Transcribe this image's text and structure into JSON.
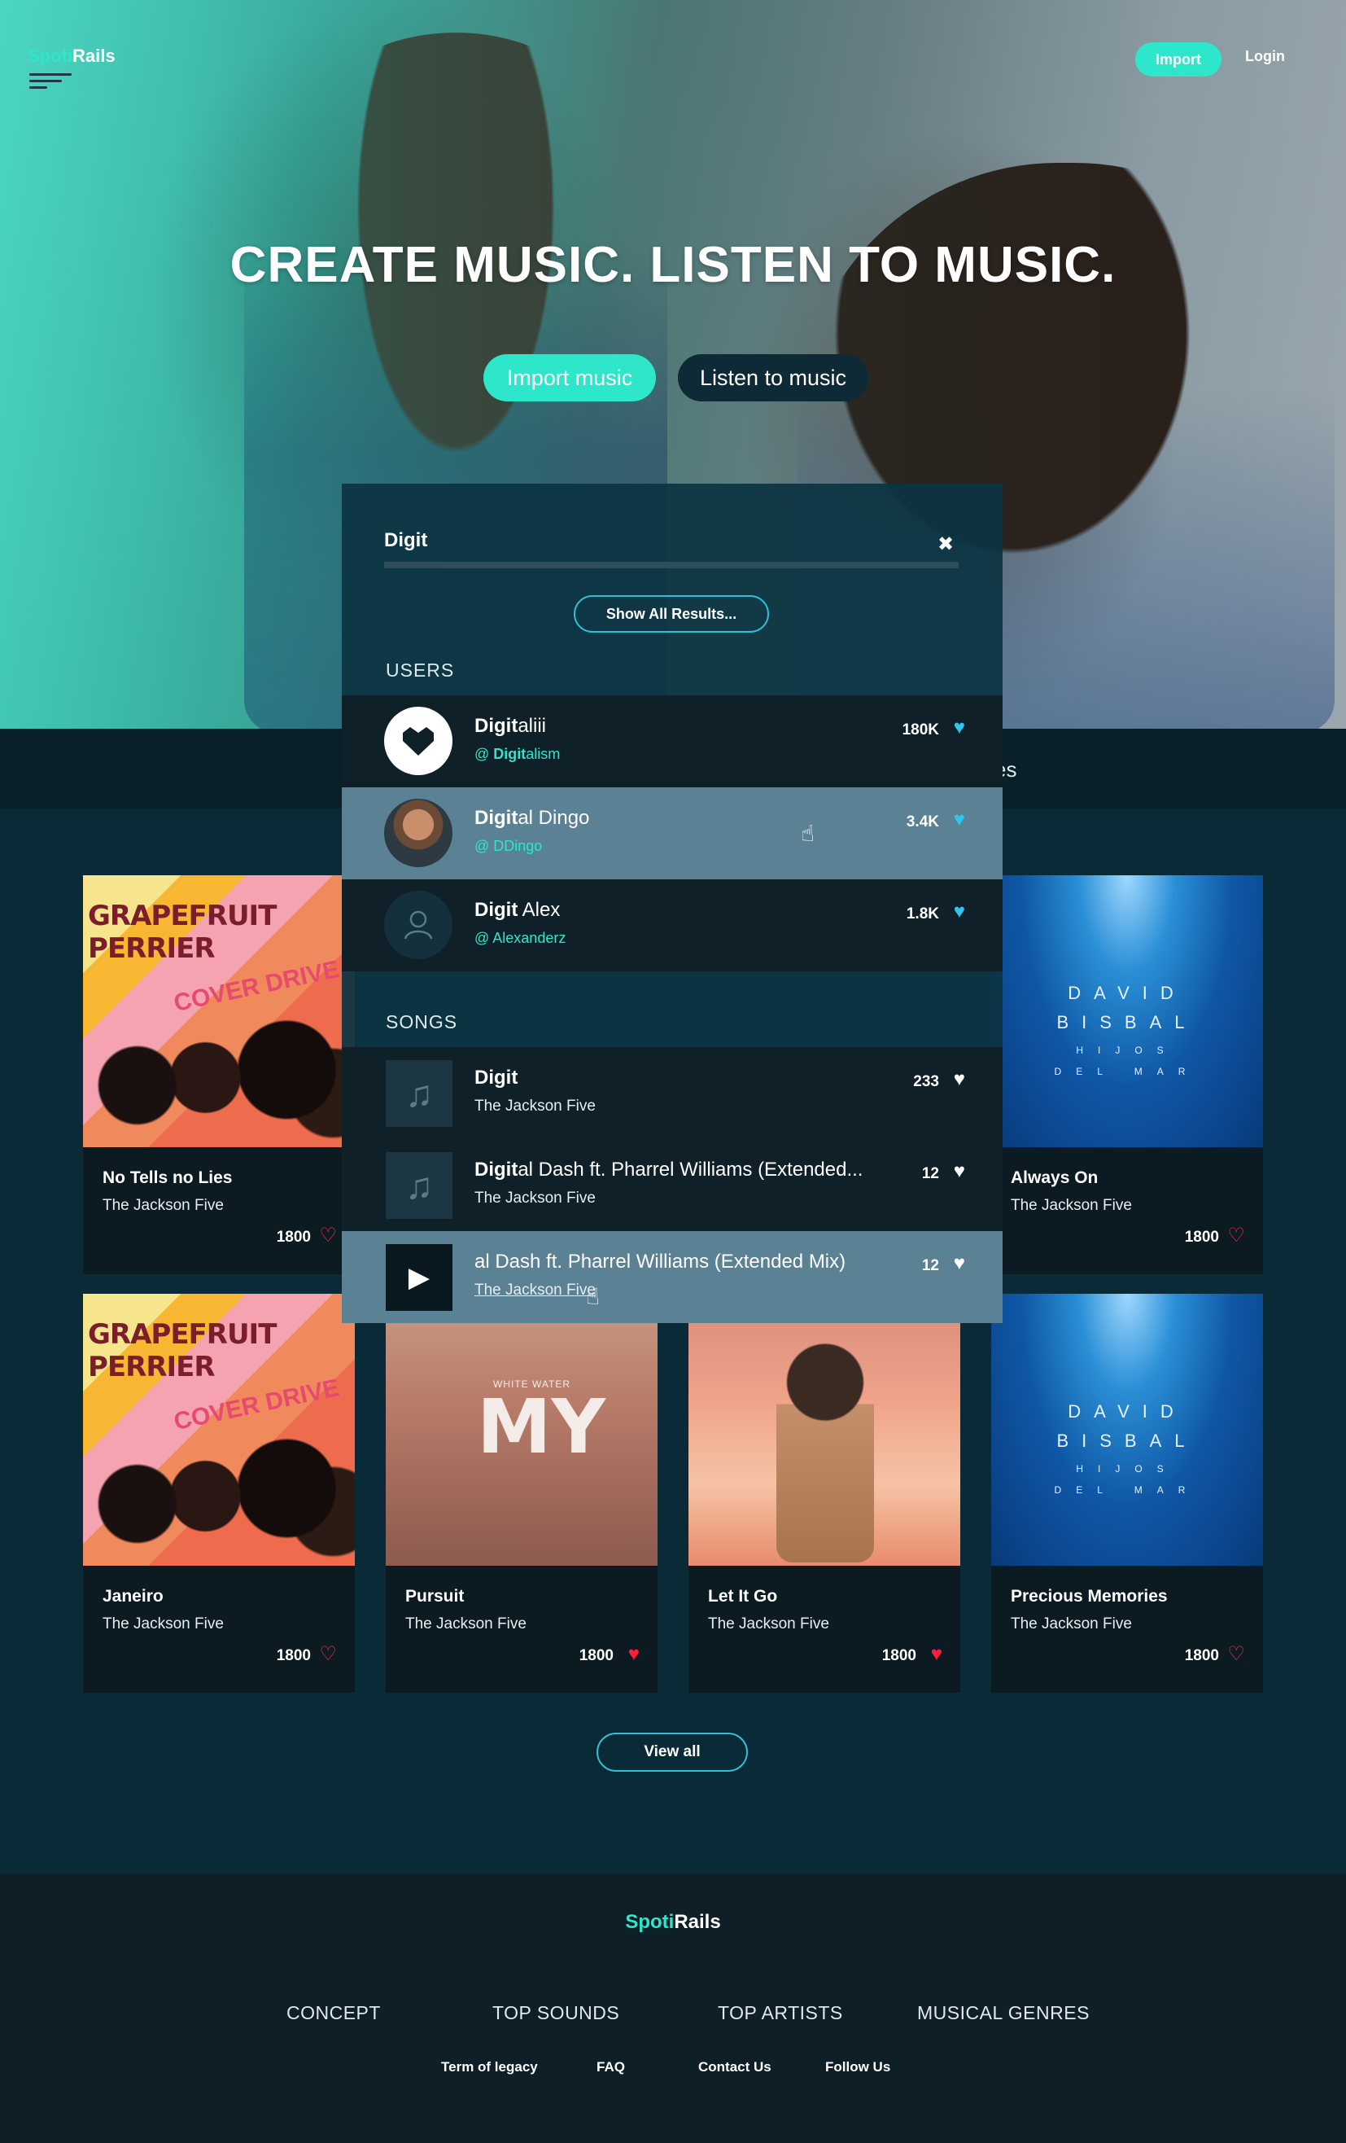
{
  "brand": {
    "part1": "Spoti",
    "part2": "Rails"
  },
  "topnav": {
    "import": "Import",
    "login": "Login"
  },
  "hero": {
    "title": "CREATE MUSIC. LISTEN TO MUSIC.",
    "btn_import": "Import music",
    "btn_listen": "Listen to music"
  },
  "filter_bar": {
    "partial_text": "es"
  },
  "search": {
    "query": "Digit",
    "show_all": "Show All Results...",
    "users_label": "USERS",
    "songs_label": "SONGS",
    "users": [
      {
        "name_match": "Digit",
        "name_rest": "aliii",
        "handle_prefix": "@ ",
        "handle_match": "Digit",
        "handle_rest": "alism",
        "count": "180K",
        "avatar": "heart-logo"
      },
      {
        "name_match": "Digit",
        "name_rest": "al Dingo",
        "handle_prefix": "@ ",
        "handle_match": "",
        "handle_rest": "DDingo",
        "count": "3.4K",
        "avatar": "photo"
      },
      {
        "name_match": "Digit",
        "name_rest": " Alex",
        "handle_prefix": "@ ",
        "handle_match": "",
        "handle_rest": "Alexanderz",
        "count": "1.8K",
        "avatar": "placeholder"
      }
    ],
    "songs": [
      {
        "title_match": "Digit",
        "title_rest": "",
        "artist": "The Jackson Five",
        "count": "233"
      },
      {
        "title_match": "Digit",
        "title_rest": "al Dash ft. Pharrel Williams (Extended...",
        "artist": "The Jackson Five",
        "count": "12"
      },
      {
        "title_match": "",
        "title_rest": "al Dash ft. Pharrel Williams (Extended Mix)",
        "artist": "The Jackson Five",
        "count": "12"
      }
    ]
  },
  "cards": [
    {
      "title": "No Tells no Lies",
      "artist": "The Jackson Five",
      "count": "1800",
      "liked": false,
      "art": "grapefruit"
    },
    {
      "title": "Always On",
      "artist": "The Jackson Five",
      "count": "1800",
      "liked": false,
      "art": "bisbal"
    },
    {
      "title": "Janeiro",
      "artist": "The Jackson Five",
      "count": "1800",
      "liked": false,
      "art": "grapefruit"
    },
    {
      "title": "Pursuit",
      "artist": "The Jackson Five",
      "count": "1800",
      "liked": true,
      "art": "my"
    },
    {
      "title": "Let It Go",
      "artist": "The Jackson Five",
      "count": "1800",
      "liked": true,
      "art": "letitgo"
    },
    {
      "title": "Precious Memories",
      "artist": "The Jackson Five",
      "count": "1800",
      "liked": false,
      "art": "bisbal"
    }
  ],
  "art_text": {
    "grapefruit_title": "GRAPEFRUIT PERRIER",
    "grapefruit_sub": "COVER DRIVE",
    "bisbal_l1": "DAVID",
    "bisbal_l2": "BISBAL",
    "bisbal_l3": "HIJOS",
    "bisbal_l4": "DEL MAR",
    "my_small": "WHITE WATER",
    "my_big": "MY"
  },
  "view_all": "View all",
  "footer": {
    "logo_part1": "Spoti",
    "logo_part2": "Rails",
    "nav": [
      "CONCEPT",
      "TOP SOUNDS",
      "TOP ARTISTS",
      "MUSICAL GENRES"
    ],
    "links": [
      "Term of legacy",
      "FAQ",
      "Contact Us",
      "Follow Us"
    ]
  },
  "colors": {
    "accent": "#2ee6c9",
    "dark": "#0b2a37",
    "heart_red": "#ff1f3d",
    "heart_cyan": "#2ec5ef",
    "highlight": "#5b8195"
  }
}
